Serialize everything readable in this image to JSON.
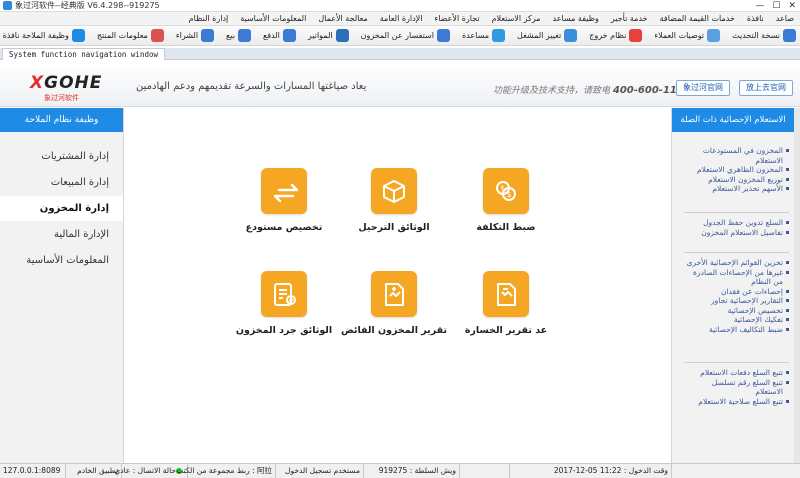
{
  "window": {
    "title": "象过河软件--经典版 V6.4.298--919275"
  },
  "menu": [
    "صاعد",
    "نافذة",
    "خدمات القيمة المضافة",
    "خدمة تأجير",
    "وظيفة مساعد",
    "مركز الاستعلام",
    "تجارة الأعضاء",
    "الإدارة العامة",
    "معالجة الأعمال",
    "المعلومات الأساسية",
    "إدارة النظام"
  ],
  "toolbar1": [
    {
      "label": "نسخة التحديث",
      "icon_name": "network-update-icon"
    },
    {
      "label": "توصيات العملاء",
      "icon_name": "customer-recommend-icon"
    },
    {
      "label": "نظام خروج",
      "icon_name": "system-exit-icon"
    },
    {
      "label": "تغيير المشغل",
      "icon_name": "change-operator-icon"
    },
    {
      "label": "مساعدة",
      "icon_name": "help-icon"
    },
    {
      "label": "استفسار عن المخزون",
      "icon_name": "inventory-query-icon"
    },
    {
      "label": "المواتير",
      "icon_name": "invoice-icon"
    },
    {
      "label": "الدفع",
      "icon_name": "payment-icon"
    },
    {
      "label": "بيع",
      "icon_name": "sale-icon"
    },
    {
      "label": "الشراء",
      "icon_name": "purchase-icon"
    },
    {
      "label": "معلومات المنتج",
      "icon_name": "product-info-icon"
    },
    {
      "label": "وظيفة الملاحة نافذة",
      "icon_name": "navigation-window-icon"
    }
  ],
  "tab": {
    "label": "System function navigation window"
  },
  "banner": {
    "logo_text": "GOHE",
    "logo_x": "X",
    "logo_sub": "象过河软件",
    "slogan": "يعاد صياغتها المسارات والسرعة تقديمهم ودعم الهادمين",
    "support_text": "功能升级及技术支持，请致电",
    "support_phone": "400-600-1168",
    "btn_site1": "象过河官网",
    "btn_site2": "放上去官网"
  },
  "left_panel": {
    "header": "وظيفة نظام الملاحة",
    "items": [
      "إدارة المشتريات",
      "إدارة المبيعات",
      "إدارة المخزون",
      "الإدارة المالية",
      "المعلومات الأساسية"
    ],
    "active_index": 2
  },
  "modules": [
    {
      "label": "تخصيص مستودع",
      "icon_name": "swap-arrows-icon"
    },
    {
      "label": "الوثائق الترحيل",
      "icon_name": "package-box-icon"
    },
    {
      "label": "ضبط التكلفة",
      "icon_name": "currency-exchange-icon"
    },
    {
      "label": "الوثائق جرد المخزون",
      "icon_name": "inventory-checklist-icon"
    },
    {
      "label": "تقرير المخزون الفائض",
      "icon_name": "surplus-report-icon"
    },
    {
      "label": "عد تقرير الخسارة",
      "icon_name": "loss-report-icon"
    }
  ],
  "right_panel": {
    "header": "الاستعلام الإحصائية ذات الصلة",
    "groups": [
      [
        "المخزون في المستودعات الاستعلام",
        "المخزون الظاهري الاستعلام",
        "توزيع المخزون الاستعلام",
        "الأسهم تحذير الاستعلام"
      ],
      [
        "السلع تدوين حفظ الجدول",
        "تفاصيل الاستعلام المخزون"
      ],
      [
        "تخزين القوائم الإحصائية الأخرى",
        "غيرها من الإحصاءات الصادرة من النظام",
        "إحصاءات عن فقدان",
        "التقارير الإحصائية تجاوز",
        "تخصيص الإحصائية",
        "تفكيك الإحصائية",
        "ضبط التكاليف الإحصائية"
      ],
      [
        "تتبع السلع دفعات الاستعلام",
        "تتبع السلع رقم تسلسل الاستعلام",
        "تتبع السلع صلاحية الاستعلام"
      ]
    ]
  },
  "statusbar": {
    "server": "127.0.0.1:8089",
    "app_label": "تطبيق الخادم",
    "conn_label": "حالة الاتصال : عادي",
    "branch": "ربط مجموعة من الكتب",
    "branch_name": "阿拉",
    "login_user": "مستخدم تسجيل الدخول",
    "serial": "919275",
    "serial_label": "ويش السلطة",
    "datetime": "11:22 05-12-2017",
    "time_label": "وقت الدخول"
  },
  "colors": {
    "accent": "#1e8be6",
    "tile": "#f5a623",
    "link": "#3b5998",
    "logo_red": "#e62e2e"
  }
}
